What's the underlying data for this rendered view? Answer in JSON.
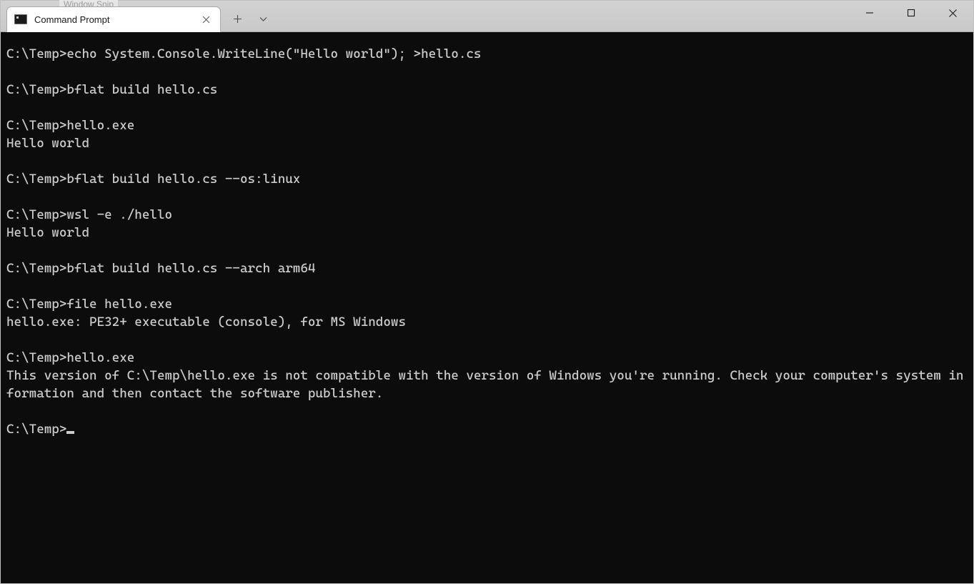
{
  "background_tab_hint": "Window Snip",
  "tab": {
    "title": "Command Prompt"
  },
  "terminal": {
    "lines": [
      "C:\\Temp>echo System.Console.WriteLine(\"Hello world\"); >hello.cs",
      "",
      "C:\\Temp>bflat build hello.cs",
      "",
      "C:\\Temp>hello.exe",
      "Hello world",
      "",
      "C:\\Temp>bflat build hello.cs --os:linux",
      "",
      "C:\\Temp>wsl -e ./hello",
      "Hello world",
      "",
      "C:\\Temp>bflat build hello.cs --arch arm64",
      "",
      "C:\\Temp>file hello.exe",
      "hello.exe: PE32+ executable (console), for MS Windows",
      "",
      "C:\\Temp>hello.exe",
      "This version of C:\\Temp\\hello.exe is not compatible with the version of Windows you're running. Check your computer's system information and then contact the software publisher.",
      ""
    ],
    "prompt_final": "C:\\Temp>"
  }
}
